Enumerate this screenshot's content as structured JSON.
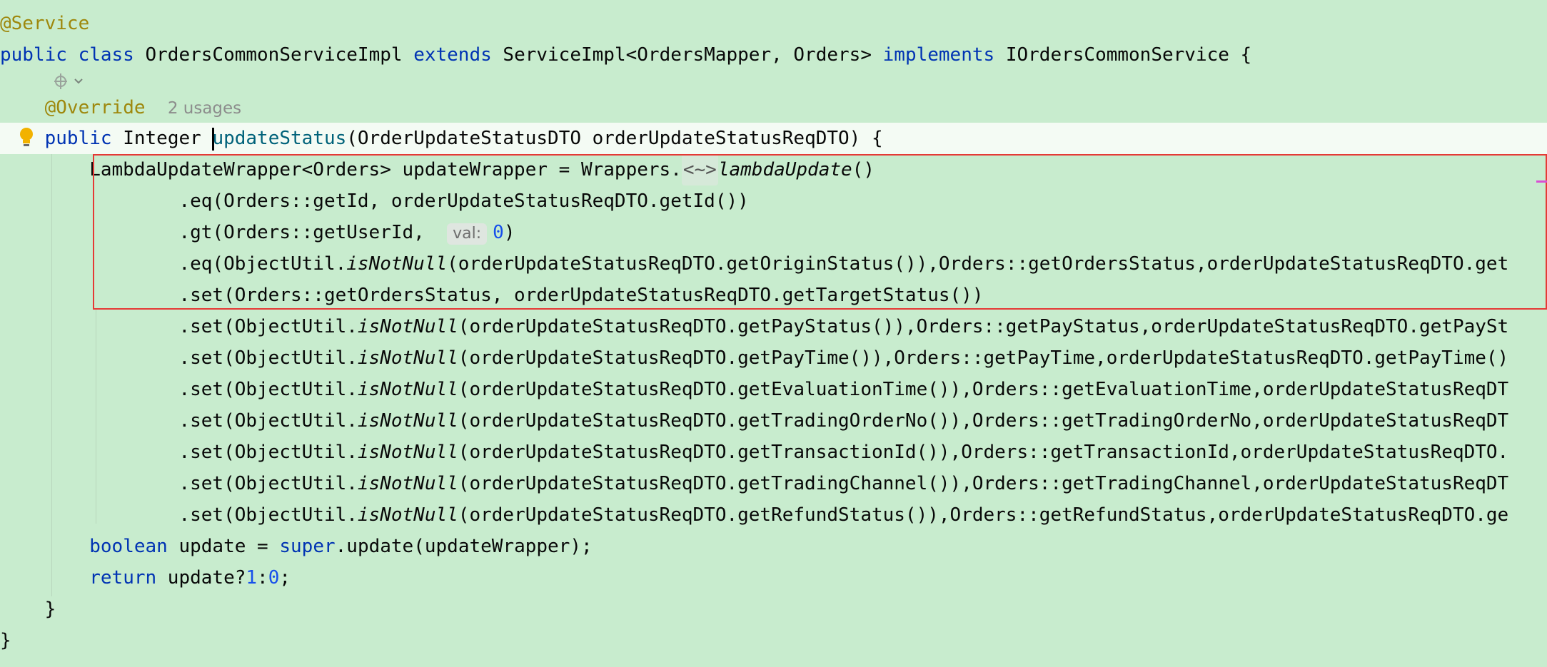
{
  "editor": {
    "lines": [
      {
        "id": "l1",
        "segments": [
          {
            "t": "@Service",
            "c": "ann"
          }
        ]
      },
      {
        "id": "l2",
        "segments": [
          {
            "t": "public class",
            "c": "kw"
          },
          {
            "t": " OrdersCommonServiceImpl "
          },
          {
            "t": "extends",
            "c": "kw"
          },
          {
            "t": " ServiceImpl<OrdersMapper, Orders> "
          },
          {
            "t": "implements",
            "c": "kw"
          },
          {
            "t": " IOrdersCommonService {"
          }
        ]
      },
      {
        "id": "l3",
        "segments": []
      },
      {
        "id": "l4",
        "segments": [
          {
            "t": "    "
          },
          {
            "t": "@Override",
            "c": "ann"
          }
        ]
      },
      {
        "id": "l5",
        "segments": [
          {
            "t": "    "
          },
          {
            "t": "public",
            "c": "kw"
          },
          {
            "t": " Integer "
          }
        ]
      },
      {
        "id": "l6",
        "segments": [
          {
            "t": "        LambdaUpdateWrapper<Orders> updateWrapper = Wrappers."
          }
        ]
      },
      {
        "id": "l7",
        "segments": [
          {
            "t": "                .eq(Orders::getId, orderUpdateStatusReqDTO.getId())"
          }
        ]
      },
      {
        "id": "l8",
        "segments": [
          {
            "t": "                .gt(Orders::getUserId,  "
          }
        ]
      },
      {
        "id": "l9",
        "segments": [
          {
            "t": "                .eq(ObjectUtil."
          },
          {
            "t": "isNotNull",
            "c": "it"
          },
          {
            "t": "(orderUpdateStatusReqDTO.getOriginStatus()),Orders::getOrdersStatus,orderUpdateStatusReqDTO.get"
          }
        ]
      },
      {
        "id": "l10",
        "segments": [
          {
            "t": "                .set(Orders::getOrdersStatus, orderUpdateStatusReqDTO.getTargetStatus())"
          }
        ]
      },
      {
        "id": "l11",
        "segments": [
          {
            "t": "                .set(ObjectUtil."
          },
          {
            "t": "isNotNull",
            "c": "it"
          },
          {
            "t": "(orderUpdateStatusReqDTO.getPayStatus()),Orders::getPayStatus,orderUpdateStatusReqDTO.getPaySt"
          }
        ]
      },
      {
        "id": "l12",
        "segments": [
          {
            "t": "                .set(ObjectUtil."
          },
          {
            "t": "isNotNull",
            "c": "it"
          },
          {
            "t": "(orderUpdateStatusReqDTO.getPayTime()),Orders::getPayTime,orderUpdateStatusReqDTO.getPayTime()"
          }
        ]
      },
      {
        "id": "l13",
        "segments": [
          {
            "t": "                .set(ObjectUtil."
          },
          {
            "t": "isNotNull",
            "c": "it"
          },
          {
            "t": "(orderUpdateStatusReqDTO.getEvaluationTime()),Orders::getEvaluationTime,orderUpdateStatusReqDT"
          }
        ]
      },
      {
        "id": "l14",
        "segments": [
          {
            "t": "                .set(ObjectUtil."
          },
          {
            "t": "isNotNull",
            "c": "it"
          },
          {
            "t": "(orderUpdateStatusReqDTO.getTradingOrderNo()),Orders::getTradingOrderNo,orderUpdateStatusReqDT"
          }
        ]
      },
      {
        "id": "l15",
        "segments": [
          {
            "t": "                .set(ObjectUtil."
          },
          {
            "t": "isNotNull",
            "c": "it"
          },
          {
            "t": "(orderUpdateStatusReqDTO.getTransactionId()),Orders::getTransactionId,orderUpdateStatusReqDTO."
          }
        ]
      },
      {
        "id": "l16",
        "segments": [
          {
            "t": "                .set(ObjectUtil."
          },
          {
            "t": "isNotNull",
            "c": "it"
          },
          {
            "t": "(orderUpdateStatusReqDTO.getTradingChannel()),Orders::getTradingChannel,orderUpdateStatusReqDT"
          }
        ]
      },
      {
        "id": "l17",
        "segments": [
          {
            "t": "                .set(ObjectUtil."
          },
          {
            "t": "isNotNull",
            "c": "it"
          },
          {
            "t": "(orderUpdateStatusReqDTO.getRefundStatus()),Orders::getRefundStatus,orderUpdateStatusReqDTO.ge"
          }
        ]
      },
      {
        "id": "l18",
        "segments": [
          {
            "t": "        "
          },
          {
            "t": "boolean",
            "c": "kw"
          },
          {
            "t": " update = "
          },
          {
            "t": "super",
            "c": "kw"
          },
          {
            "t": ".update(updateWrapper);"
          }
        ]
      },
      {
        "id": "l19",
        "segments": [
          {
            "t": "        "
          },
          {
            "t": "return",
            "c": "kw"
          },
          {
            "t": " update?"
          },
          {
            "t": "1",
            "c": "num"
          },
          {
            "t": ":"
          },
          {
            "t": "0",
            "c": "num"
          },
          {
            "t": ";"
          }
        ]
      },
      {
        "id": "l20",
        "segments": [
          {
            "t": "    }"
          }
        ]
      },
      {
        "id": "l21",
        "segments": [
          {
            "t": "}"
          }
        ]
      }
    ],
    "usages_hint": "2 usages",
    "method_name_first": "u",
    "method_name_rest": "pdateStatus",
    "method_params": "(OrderUpdateStatusDTO orderUpdateStatusReqDTO) {",
    "type_hint": "<~>",
    "lambda_update": "lambdaUpdate",
    "lambda_update_tail": "()",
    "param_hint": "val:",
    "gt_value": "0",
    "gt_tail": ")",
    "colors": {
      "background": "#c8ecce",
      "current_line": "#f4fbf4",
      "keyword": "#0033b3",
      "annotation": "#9e880d",
      "number": "#1750eb",
      "method": "#00627a",
      "selection_border": "#e53935"
    }
  }
}
